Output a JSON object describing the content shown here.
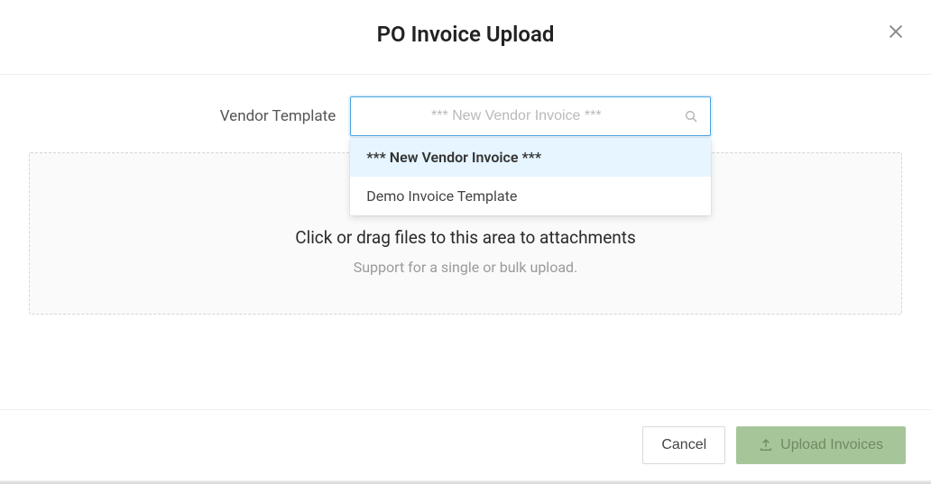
{
  "header": {
    "title": "PO Invoice Upload"
  },
  "vendorTemplate": {
    "label": "Vendor Template",
    "placeholder": "*** New Vendor Invoice ***",
    "options": [
      {
        "label": "*** New Vendor Invoice ***",
        "selected": true
      },
      {
        "label": "Demo Invoice Template",
        "selected": false
      }
    ]
  },
  "dropzone": {
    "title": "Click or drag files to this area to attachments",
    "subtitle": "Support for a single or bulk upload."
  },
  "footer": {
    "cancel": "Cancel",
    "upload": "Upload Invoices"
  }
}
